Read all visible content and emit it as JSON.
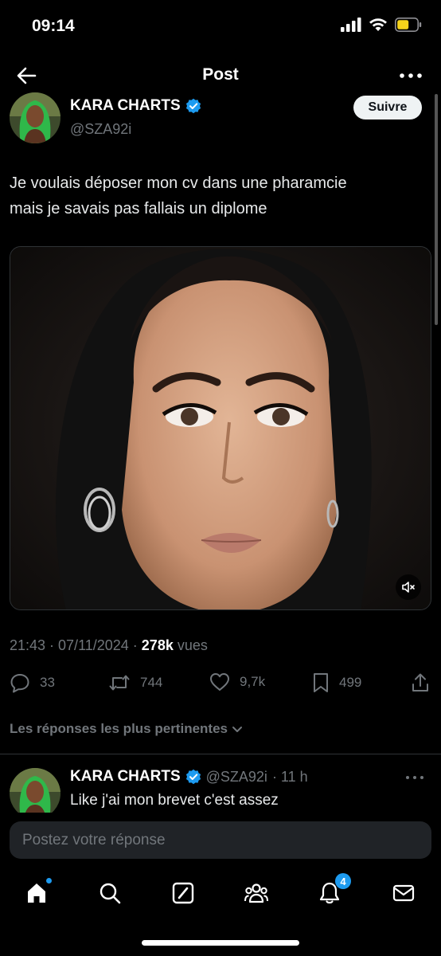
{
  "status_bar": {
    "time": "09:14"
  },
  "nav": {
    "title": "Post",
    "back_icon": "arrow-left-icon",
    "more_icon": "more-horizontal-icon"
  },
  "author": {
    "name": "KARA CHARTS",
    "handle": "@SZA92i",
    "verified": true,
    "follow_label": "Suivre"
  },
  "tweet": {
    "text_line1": "Je voulais déposer mon cv dans une pharamcie",
    "text_line2": "mais je savais pas fallais un diplome",
    "media_type": "video",
    "timestamp": "21:43 · 07/11/2024 · ",
    "views_count": "278k",
    "views_label": " vues"
  },
  "actions": {
    "replies": "33",
    "reposts": "744",
    "likes": "9,7k",
    "bookmarks": "499"
  },
  "replies_sort_label": "Les réponses les plus pertinentes",
  "reply": {
    "name": "KARA CHARTS",
    "handle": "@SZA92i",
    "time": "· 11 h",
    "text": "Like j'ai mon brevet c'est assez"
  },
  "composer": {
    "placeholder": "Postez votre réponse"
  },
  "tabbar": {
    "notifications_badge": "4"
  },
  "colors": {
    "accent": "#1d9bf0",
    "background": "#000000",
    "secondary_text": "#71767b",
    "battery": "#f5d31b"
  }
}
